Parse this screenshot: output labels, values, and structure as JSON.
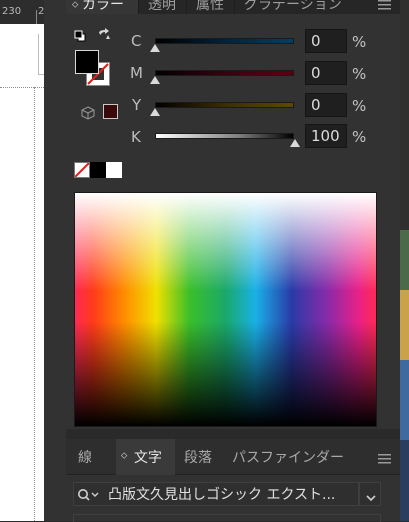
{
  "ruler": {
    "value": "230",
    "next": "2"
  },
  "top_tabs": [
    {
      "label": "カラー",
      "active": true
    },
    {
      "label": "透明"
    },
    {
      "label": "属性"
    },
    {
      "label": "グラデーション"
    }
  ],
  "color": {
    "mode": "CMYK",
    "rows": [
      {
        "label": "C",
        "value": "0",
        "unit": "%"
      },
      {
        "label": "M",
        "value": "0",
        "unit": "%"
      },
      {
        "label": "Y",
        "value": "0",
        "unit": "%"
      },
      {
        "label": "K",
        "value": "100",
        "unit": "%"
      }
    ],
    "fill_color": "#000000",
    "stroke": "none",
    "gamut_swatch_color": "#3a0a0a"
  },
  "bottom_tabs": [
    {
      "label": "線"
    },
    {
      "label": "文字",
      "active": true
    },
    {
      "label": "段落"
    },
    {
      "label": "パスファインダー"
    }
  ],
  "character": {
    "font_name": "凸版文久見出しゴシック エクスト..."
  },
  "icons": [
    "menu-icon",
    "search-icon",
    "chevron-down-icon",
    "swap-icon",
    "default-colors-icon",
    "cube-icon",
    "none-swatch-icon"
  ]
}
